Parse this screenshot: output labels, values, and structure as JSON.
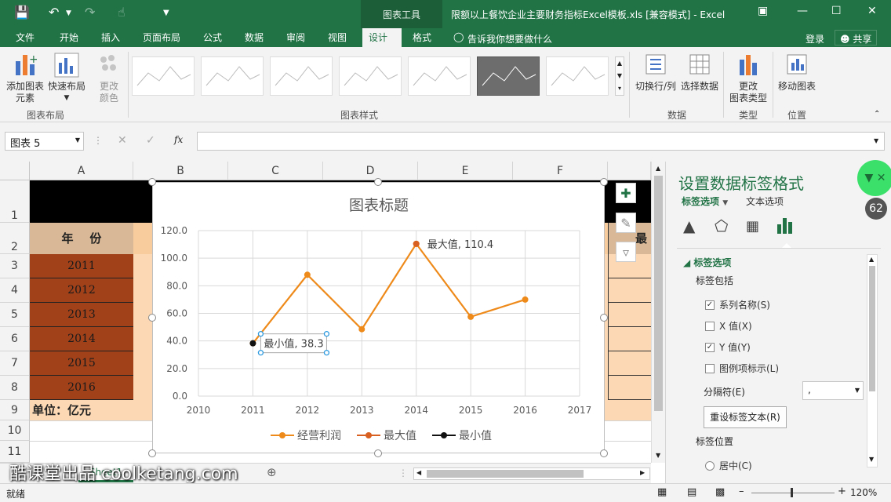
{
  "titlebar": {
    "tool_context": "图表工具",
    "doc_title": "限额以上餐饮企业主要财务指标Excel模板.xls  [兼容模式] - Excel"
  },
  "tabs": [
    "文件",
    "开始",
    "插入",
    "页面布局",
    "公式",
    "数据",
    "审阅",
    "视图",
    "设计",
    "格式"
  ],
  "tell_me": "告诉我你想要做什么",
  "login": "登录",
  "share": "共享",
  "ribbon": {
    "add_element": "添加图表\n元素",
    "add_element_1": "添加图表",
    "add_element_2": "元素",
    "quick_layout": "快速布局",
    "change_color_1": "更改",
    "change_color_2": "颜色",
    "group_layout": "图表布局",
    "group_styles": "图表样式",
    "switch_rowcol": "切换行/列",
    "select_data": "选择数据",
    "group_data": "数据",
    "change_type_1": "更改",
    "change_type_2": "图表类型",
    "group_type": "类型",
    "move_chart": "移动图表",
    "group_location": "位置"
  },
  "formula": {
    "namebox": "图表 5",
    "fx": "fx"
  },
  "columns": [
    "A",
    "B",
    "C",
    "D",
    "E",
    "F"
  ],
  "rows": [
    "1",
    "2",
    "3",
    "4",
    "5",
    "6",
    "7",
    "8",
    "9",
    "10",
    "11"
  ],
  "cells": {
    "a2": "年    份",
    "years": [
      "2011",
      "2012",
      "2013",
      "2014",
      "2015",
      "2016"
    ],
    "a9": "单位：亿元",
    "g2_partial": "最"
  },
  "chart_data": {
    "type": "line",
    "title": "图表标题",
    "x": [
      "2010",
      "2011",
      "2012",
      "2013",
      "2014",
      "2015",
      "2016",
      "2017"
    ],
    "ylim": [
      0,
      120
    ],
    "yticks": [
      "0.0",
      "20.0",
      "40.0",
      "60.0",
      "80.0",
      "100.0",
      "120.0"
    ],
    "series": [
      {
        "name": "经营利润",
        "color": "#ee8a1a",
        "points": [
          [
            2011,
            38.3
          ],
          [
            2012,
            88
          ],
          [
            2013,
            48.5
          ],
          [
            2014,
            110.4
          ],
          [
            2015,
            57.5
          ],
          [
            2016,
            70
          ]
        ]
      },
      {
        "name": "最大值",
        "color": "#d86020",
        "points": [
          [
            2014,
            110.4
          ]
        ]
      },
      {
        "name": "最小值",
        "color": "#111111",
        "points": [
          [
            2011,
            38.3
          ]
        ]
      }
    ],
    "data_labels": [
      {
        "text": "最大值, 110.4",
        "x": 2014,
        "y": 110.4
      },
      {
        "text": "最小值, 38.3",
        "x": 2011,
        "y": 38.3
      }
    ],
    "legend": "bottom",
    "grid": true
  },
  "sheet_tab": "Sheet1",
  "status": {
    "ready": "就绪",
    "zoom": "120%"
  },
  "pane": {
    "title": "设置数据标签格式",
    "tab_label_options": "标签选项",
    "tab_text_options": "文本选项",
    "section": "标签选项",
    "includes": "标签包括",
    "series_name": "系列名称(S)",
    "x_value": "X 值(X)",
    "y_value": "Y 值(Y)",
    "legend_key": "图例项标示(L)",
    "separator_label": "分隔符(E)",
    "separator_value": ",",
    "reset_btn": "重设标签文本(R)",
    "position": "标签位置",
    "center": "居中(C)",
    "badge": "62"
  },
  "watermark": "酷课堂出品 coolketang.com"
}
